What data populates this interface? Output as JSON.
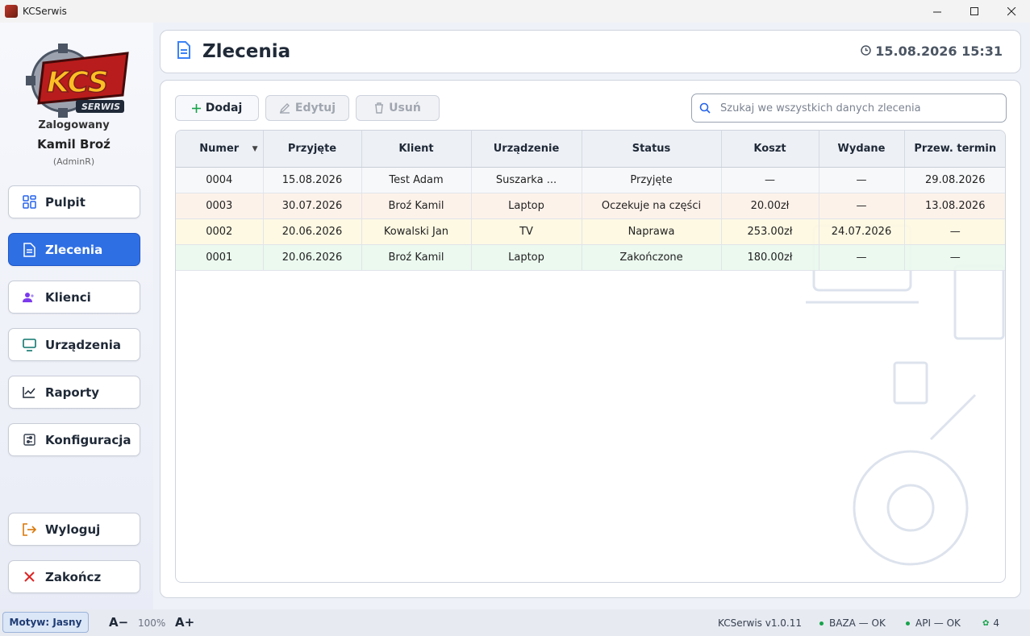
{
  "window": {
    "title": "KCSerwis"
  },
  "sidebar": {
    "logo": {
      "main": "KCS",
      "sub": "SERWIS"
    },
    "logged_label": "Zalogowany",
    "user_name": "Kamil Broź",
    "user_role": "(AdminR)",
    "items": [
      {
        "label": "Pulpit",
        "icon": "dashboard-icon"
      },
      {
        "label": "Zlecenia",
        "icon": "document-icon",
        "active": true
      },
      {
        "label": "Klienci",
        "icon": "users-icon"
      },
      {
        "label": "Urządzenia",
        "icon": "monitor-icon"
      },
      {
        "label": "Raporty",
        "icon": "chart-icon"
      },
      {
        "label": "Konfiguracja",
        "icon": "settings-sliders-icon"
      }
    ],
    "logout_label": "Wyloguj",
    "exit_label": "Zakończ"
  },
  "header": {
    "title": "Zlecenia",
    "datetime": "15.08.2026 15:31"
  },
  "toolbar": {
    "add_label": "Dodaj",
    "edit_label": "Edytuj",
    "delete_label": "Usuń",
    "search_placeholder": "Szukaj we wszystkich danych zlecenia"
  },
  "table": {
    "columns": [
      "Numer",
      "Przyjęte",
      "Klient",
      "Urządzenie",
      "Status",
      "Koszt",
      "Wydane",
      "Przew. termin"
    ],
    "sort_indicator": "▼",
    "rows": [
      {
        "id": "0004",
        "cells": [
          "0004",
          "15.08.2026",
          "Test Adam",
          "Suszarka ...",
          "Przyjęte",
          "—",
          "—",
          "29.08.2026"
        ]
      },
      {
        "id": "0003",
        "cells": [
          "0003",
          "30.07.2026",
          "Broź Kamil",
          "Laptop",
          "Oczekuje na części",
          "20.00zł",
          "—",
          "13.08.2026"
        ]
      },
      {
        "id": "0002",
        "cells": [
          "0002",
          "20.06.2026",
          "Kowalski Jan",
          "TV",
          "Naprawa",
          "253.00zł",
          "24.07.2026",
          "—"
        ]
      },
      {
        "id": "0001",
        "cells": [
          "0001",
          "20.06.2026",
          "Broź Kamil",
          "Laptop",
          "Zakończone",
          "180.00zł",
          "—",
          "—"
        ]
      }
    ]
  },
  "statusbar": {
    "theme_label": "Motyw: Jasny",
    "font_minus": "A−",
    "zoom": "100%",
    "font_plus": "A+",
    "version": "KCSerwis v1.0.11",
    "db_status": "BAZA — OK",
    "api_status": "API — OK",
    "users_count": "4"
  },
  "colors": {
    "accent": "#2f6fe4",
    "row_received": "#f6f7fa",
    "row_waiting": "#fdf1e8",
    "row_repair": "#fdf8e1",
    "row_done": "#e9f8ee",
    "ok": "#16a34a"
  }
}
